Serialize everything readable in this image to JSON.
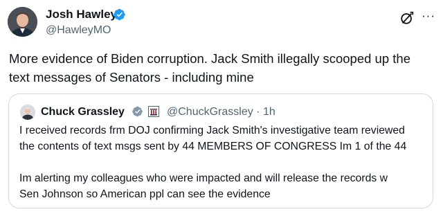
{
  "tweet": {
    "author_name": "Josh Hawley",
    "author_handle": "@HawleyMO",
    "verified_icon": "verified-badge-icon",
    "actions": {
      "grok_icon": "grok-icon",
      "more_label": "···"
    },
    "text": "More evidence of Biden corruption. Jack Smith illegally scooped up the\ntext messages of Senators - including mine"
  },
  "quote": {
    "author_name": "Chuck Grassley",
    "handle_time": "@ChuckGrassley · 1h",
    "verified_icon": "verified-badge-gray-icon",
    "affiliate_icon": "senate-badge-icon",
    "text": "I received records frm DOJ confirming Jack Smith's investigative team reviewed\nthe contents of text msgs sent by 44 MEMBERS OF CONGRESS Im 1 of the 44\n\nIm alerting my colleagues who were impacted and will release the records w\nSen Johnson so American ppl can see the evidence"
  },
  "colors": {
    "text_primary": "#0f1419",
    "text_secondary": "#536471",
    "verified_blue": "#1d9bf0",
    "verified_gray": "#829aab",
    "border": "#cfd9de"
  }
}
